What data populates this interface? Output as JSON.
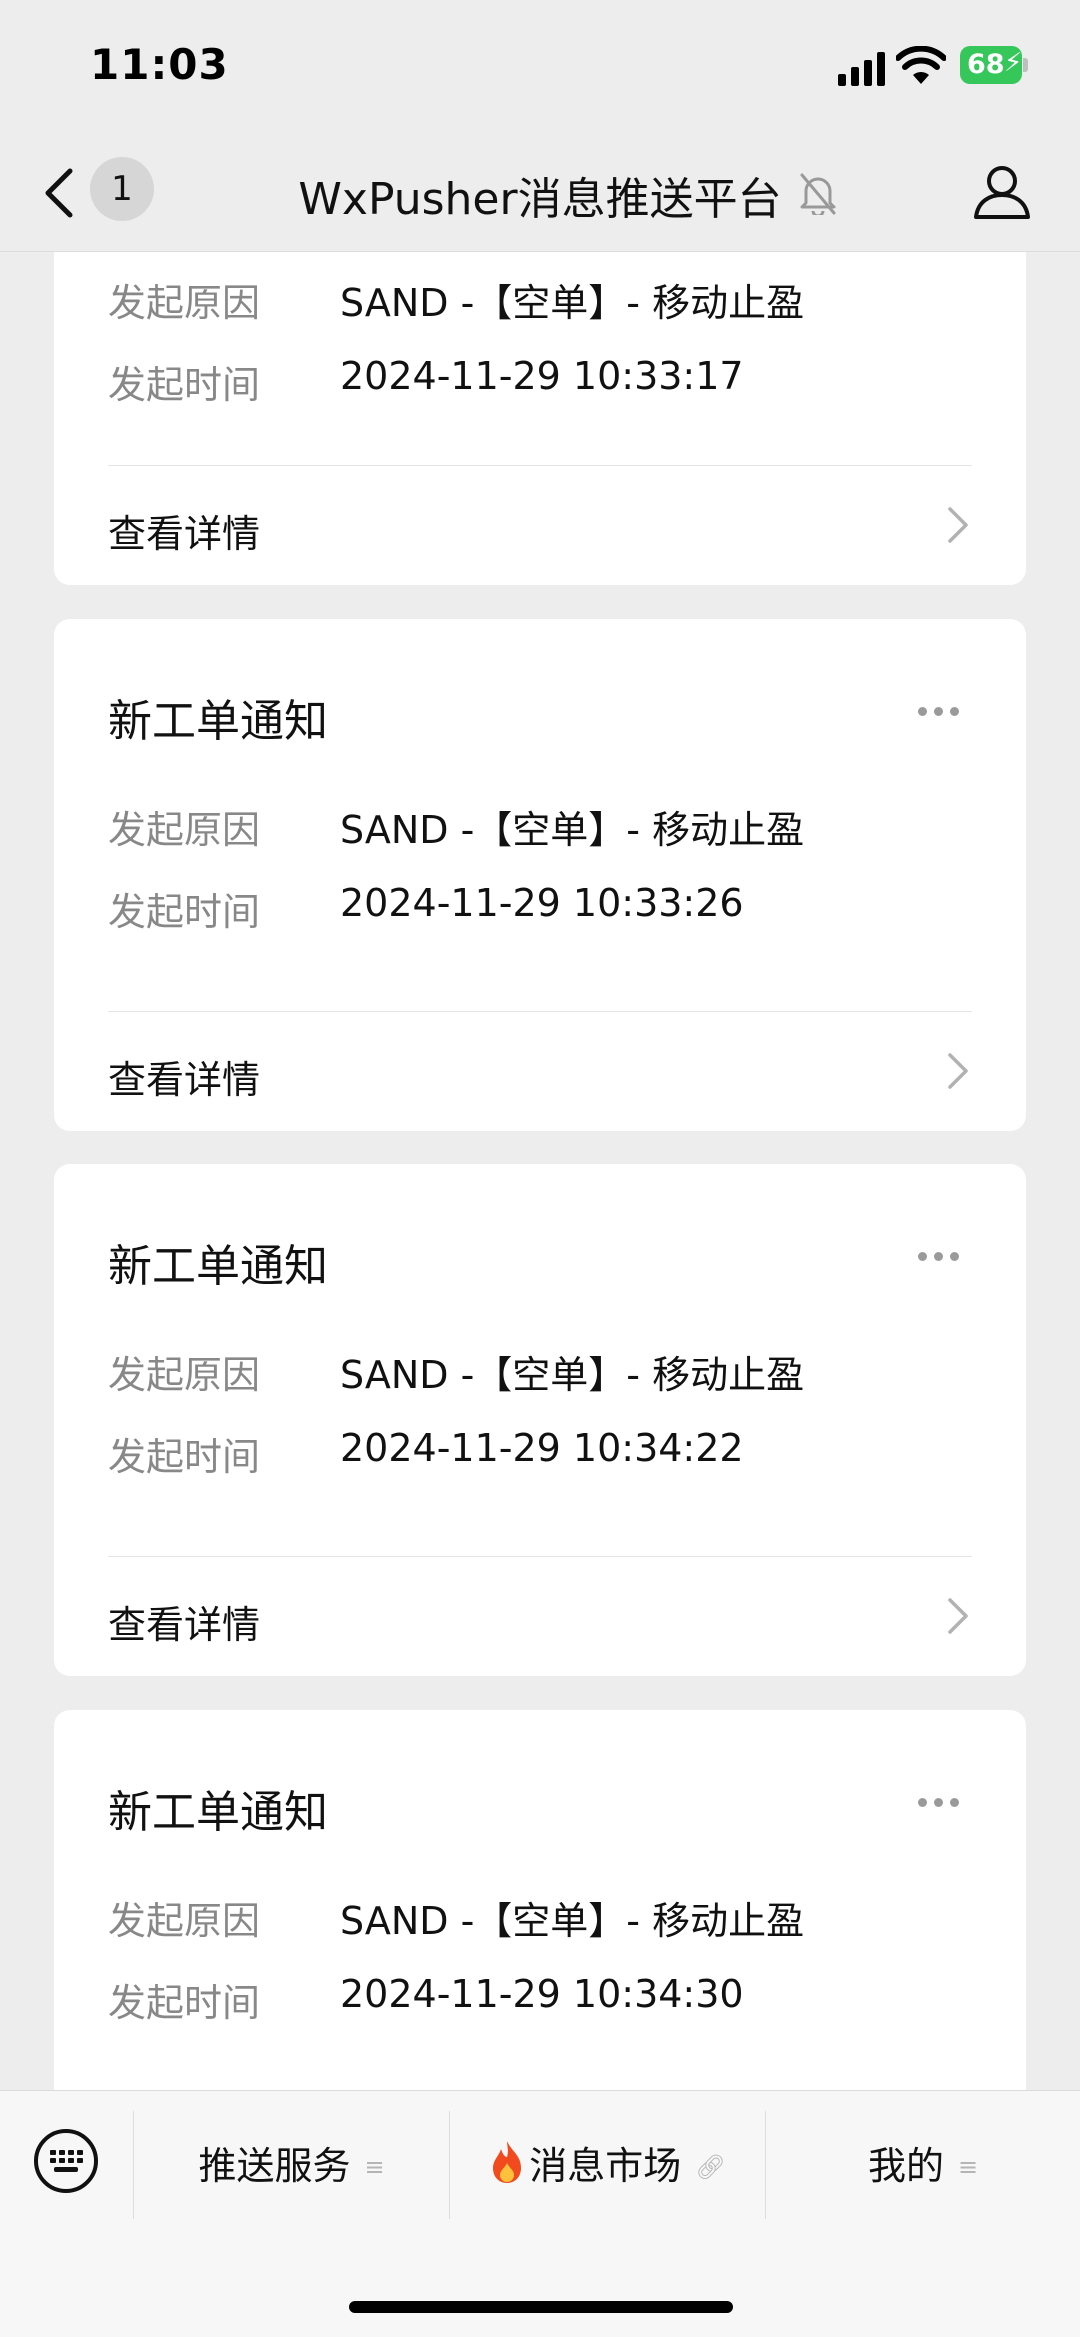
{
  "status_bar": {
    "time": "11:03",
    "battery_percent": "68"
  },
  "nav": {
    "unread_count": "1",
    "title": "WxPusher消息推送平台"
  },
  "cards": [
    {
      "title": "",
      "reason_label": "发起原因",
      "reason_value": "SAND -【空单】- 移动止盈",
      "time_label": "发起时间",
      "time_value": "2024-11-29 10:33:17",
      "detail_label": "查看详情"
    },
    {
      "title": "新工单通知",
      "reason_label": "发起原因",
      "reason_value": "SAND -【空单】- 移动止盈",
      "time_label": "发起时间",
      "time_value": "2024-11-29 10:33:26",
      "detail_label": "查看详情"
    },
    {
      "title": "新工单通知",
      "reason_label": "发起原因",
      "reason_value": "SAND -【空单】- 移动止盈",
      "time_label": "发起时间",
      "time_value": "2024-11-29 10:34:22",
      "detail_label": "查看详情"
    },
    {
      "title": "新工单通知",
      "reason_label": "发起原因",
      "reason_value": "SAND -【空单】- 移动止盈",
      "time_label": "发起时间",
      "time_value": "2024-11-29 10:34:30",
      "detail_label": ""
    }
  ],
  "bottom_menu": {
    "items": [
      {
        "label": "推送服务",
        "icon": "menu-lines-icon"
      },
      {
        "label": "消息市场",
        "icon": "link-icon",
        "prefix_icon": "fire-icon"
      },
      {
        "label": "我的",
        "icon": "menu-lines-icon"
      }
    ]
  },
  "colors": {
    "background": "#ededed",
    "card": "#ffffff",
    "label_gray": "#888888",
    "battery_green": "#35c759"
  }
}
